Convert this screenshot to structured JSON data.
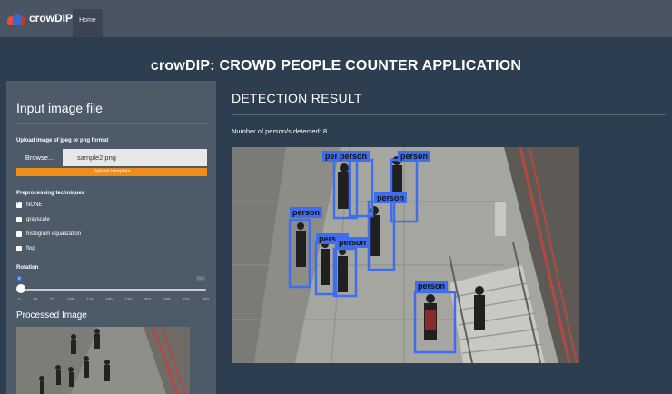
{
  "navbar": {
    "brand": "crowDIP",
    "home_label": "Home"
  },
  "app_title": "crowDIP: CROWD PEOPLE COUNTER APPLICATION",
  "sidebar": {
    "heading": "Input image file",
    "upload_label": "Upload image of jpeg or png format",
    "browse_label": "Browse...",
    "file_name": "sample2.png",
    "upload_status": "Upload complete",
    "preprocessing_label": "Preprocessing techniques",
    "options": [
      {
        "label": "NONE",
        "checked": true
      },
      {
        "label": "grayscale",
        "checked": false
      },
      {
        "label": "histogram equalization",
        "checked": false
      },
      {
        "label": "flop",
        "checked": false
      }
    ],
    "rotation_label": "Rotation",
    "rotation_value": "0",
    "rotation_max": "360",
    "ticks": [
      "0",
      "36",
      "72",
      "108",
      "144",
      "180",
      "216",
      "252",
      "288",
      "324",
      "360"
    ],
    "processed_heading": "Processed Image"
  },
  "main": {
    "heading": "DETECTION RESULT",
    "count_text": "Number of person/s detected: 8",
    "box_label": "person",
    "box_color": "#3f6df0"
  },
  "colors": {
    "background": "#2c3e50",
    "navbar": "#4a5563",
    "sidebar": "#4d5b69",
    "progress": "#f08c1a"
  }
}
